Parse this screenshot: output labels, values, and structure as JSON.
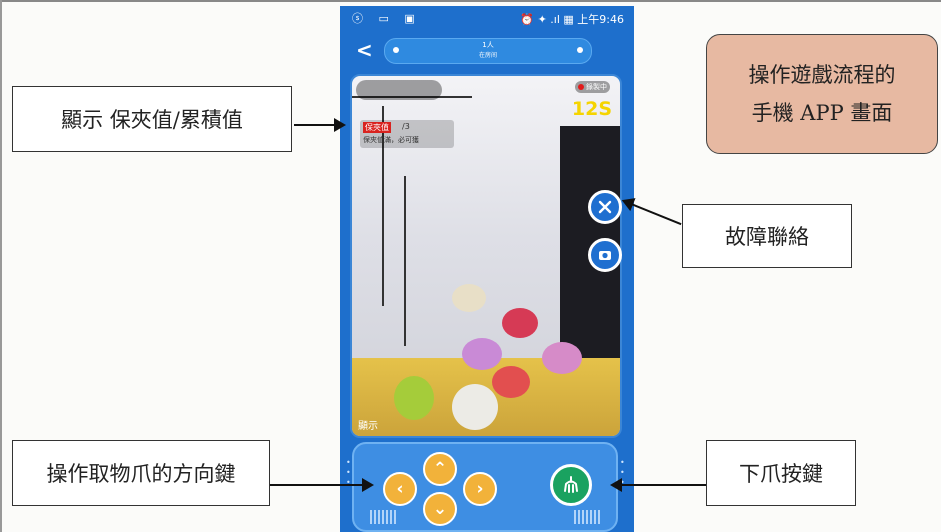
{
  "annotations": {
    "display_value": "顯示 保夾值/累積值",
    "title_line1": "操作遊戲流程的",
    "title_line2": "手機 APP 畫面",
    "fault_contact": "故障聯絡",
    "direction_keys": "操作取物爪的方向鍵",
    "drop_claw": "下爪按鍵"
  },
  "status_bar": {
    "icons_left": "ⓢ ▭ ▣",
    "right": "⏰ ✦ .ıl ▦ 上午9:46"
  },
  "room": {
    "count": "1人",
    "status": "在房间"
  },
  "video": {
    "recording_label": "錄製中",
    "timer": "12S",
    "score_label": "保夾值",
    "score_value": "/3",
    "score_sub": "保夾值滿，必可獲",
    "display_label": "顯示"
  },
  "side_buttons": {
    "fault_icon": "wrench-cross-icon",
    "camera_icon": "camera-switch-icon"
  },
  "controls": {
    "up": "⌃",
    "down": "⌄",
    "left": "‹",
    "right": "›",
    "claw_icon": "claw-icon"
  },
  "colors": {
    "phone_blue": "#1e6fcc",
    "dpad_orange": "#f2b23a",
    "claw_green": "#1aa260",
    "title_box": "#e7b9a2",
    "timer_yellow": "#f5d400"
  }
}
